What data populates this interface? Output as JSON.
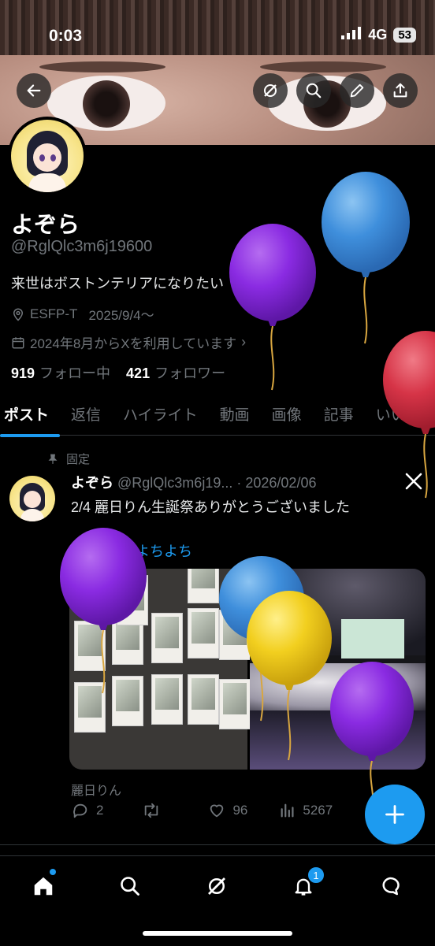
{
  "status_bar": {
    "time": "0:03",
    "network": "4G",
    "battery": "53"
  },
  "header": {
    "icons": [
      "back-arrow-icon",
      "grok-icon",
      "search-icon",
      "edit-icon",
      "share-icon"
    ]
  },
  "profile": {
    "name": "よぞら",
    "handle": "@RglQlc3m6j19600",
    "bio": "来世はボストンテリアになりたい",
    "location": "ESFP-T",
    "birthday": "2025/9/4～",
    "joined": "2024年8月からXを利用しています",
    "following_count": "919",
    "following_label": "フォロー中",
    "followers_count": "421",
    "followers_label": "フォロワー"
  },
  "tabs": [
    "ポスト",
    "返信",
    "ハイライト",
    "動画",
    "画像",
    "記事",
    "いいね"
  ],
  "post": {
    "pinned_label": "固定",
    "author": "よぞら",
    "handle": "@RglQlc3m6j19...",
    "sep": "·",
    "date": "2026/02/06",
    "text": "2/4 麗日りん生誕祭ありがとうございました",
    "hashtag": "#りんりんよちよち",
    "tagged": "麗日りん",
    "replies": "2",
    "likes": "96",
    "views": "5267"
  },
  "colors": {
    "accent": "#1d9bf0",
    "muted": "#71767b",
    "text": "#e7e9ea",
    "bg": "#000000"
  },
  "bottom_nav": {
    "notification_badge": "1"
  }
}
